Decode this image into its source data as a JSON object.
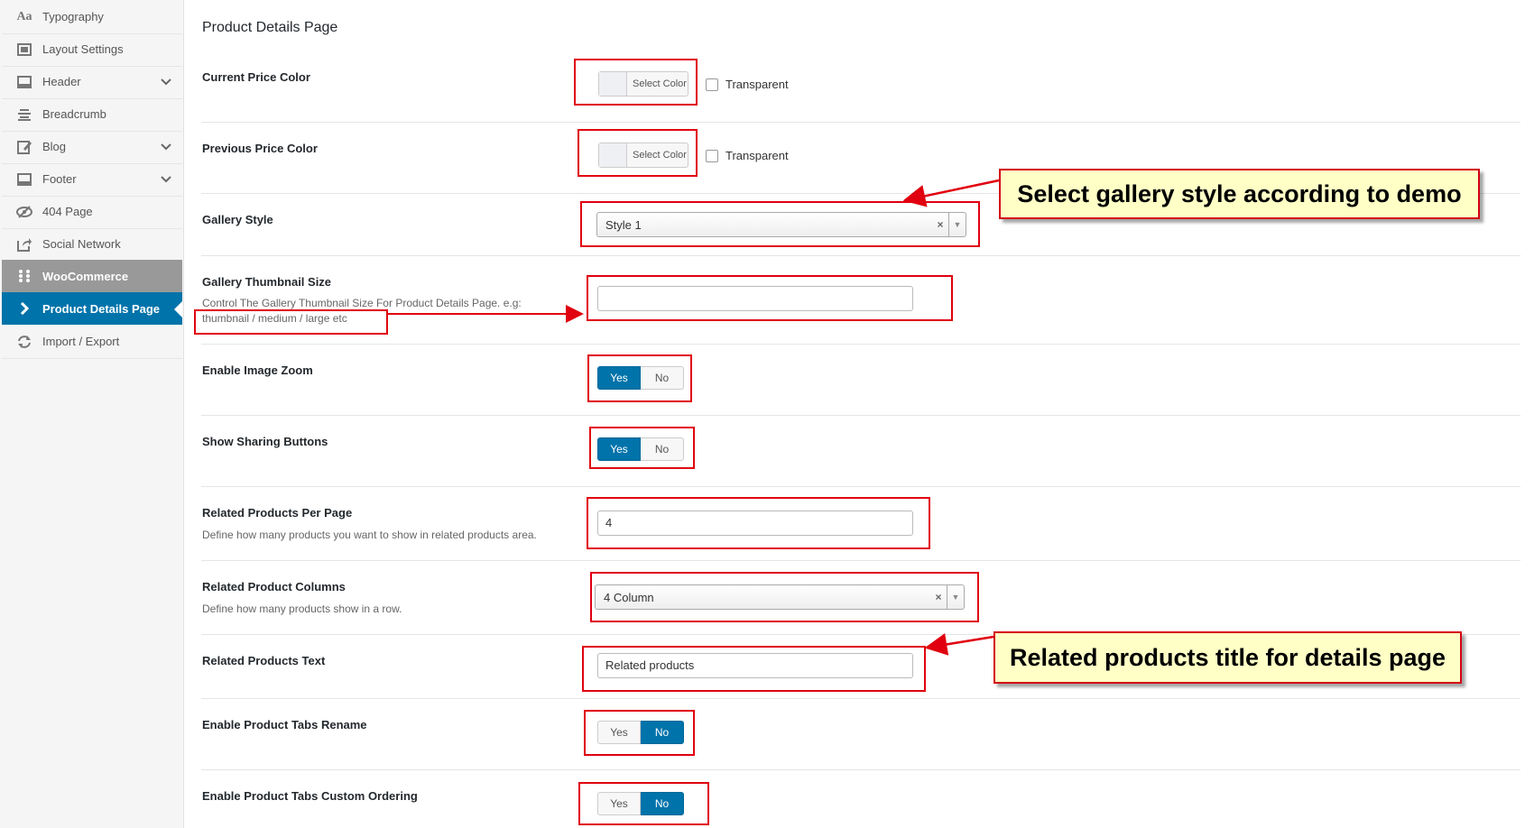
{
  "sidebar": {
    "items": [
      {
        "label": "Typography",
        "icon": "typography-icon"
      },
      {
        "label": "Layout Settings",
        "icon": "layout-icon"
      },
      {
        "label": "Header",
        "icon": "header-icon"
      },
      {
        "label": "Breadcrumb",
        "icon": "breadcrumb-icon"
      },
      {
        "label": "Blog",
        "icon": "blog-icon"
      },
      {
        "label": "Footer",
        "icon": "footer-icon"
      },
      {
        "label": "404 Page",
        "icon": "hidden-eye-icon"
      },
      {
        "label": "Social Network",
        "icon": "share-icon"
      },
      {
        "label": "WooCommerce",
        "icon": "grid-dots-icon"
      },
      {
        "label": "Product Details Page",
        "icon": "chevron-right-icon"
      },
      {
        "label": "Import / Export",
        "icon": "refresh-icon"
      }
    ]
  },
  "main": {
    "title": "Product Details Page",
    "fields": {
      "current_price_color": {
        "label": "Current Price Color",
        "button": "Select Color",
        "checkbox": "Transparent"
      },
      "previous_price_color": {
        "label": "Previous Price Color",
        "button": "Select Color",
        "checkbox": "Transparent"
      },
      "gallery_style": {
        "label": "Gallery Style",
        "value": "Style 1",
        "clear": "×",
        "arrow": "▼"
      },
      "gallery_thumb": {
        "label": "Gallery Thumbnail Size",
        "desc1": "Control The Gallery Thumbnail Size For Product Details Page. e.g:",
        "desc2": "thumbnail / medium / large etc",
        "value": ""
      },
      "image_zoom": {
        "label": "Enable Image Zoom",
        "yes": "Yes",
        "no": "No",
        "selected": "Yes"
      },
      "sharing": {
        "label": "Show Sharing Buttons",
        "yes": "Yes",
        "no": "No",
        "selected": "Yes"
      },
      "related_per_page": {
        "label": "Related Products Per Page",
        "desc": "Define how many products you want to show in related products area.",
        "value": "4"
      },
      "related_columns": {
        "label": "Related Product Columns",
        "desc": "Define how many products show in a row.",
        "value": "4 Column",
        "clear": "×",
        "arrow": "▼"
      },
      "related_text": {
        "label": "Related Products Text",
        "value": "Related products"
      },
      "tabs_rename": {
        "label": "Enable Product Tabs Rename",
        "yes": "Yes",
        "no": "No",
        "selected": "No"
      },
      "tabs_ordering": {
        "label": "Enable Product Tabs Custom Ordering",
        "yes": "Yes",
        "no": "No",
        "selected": "No"
      }
    }
  },
  "annotations": {
    "callout_gallery": "Select gallery style according to demo",
    "callout_related": "Related products title for details page",
    "accent": "#e0000f"
  }
}
